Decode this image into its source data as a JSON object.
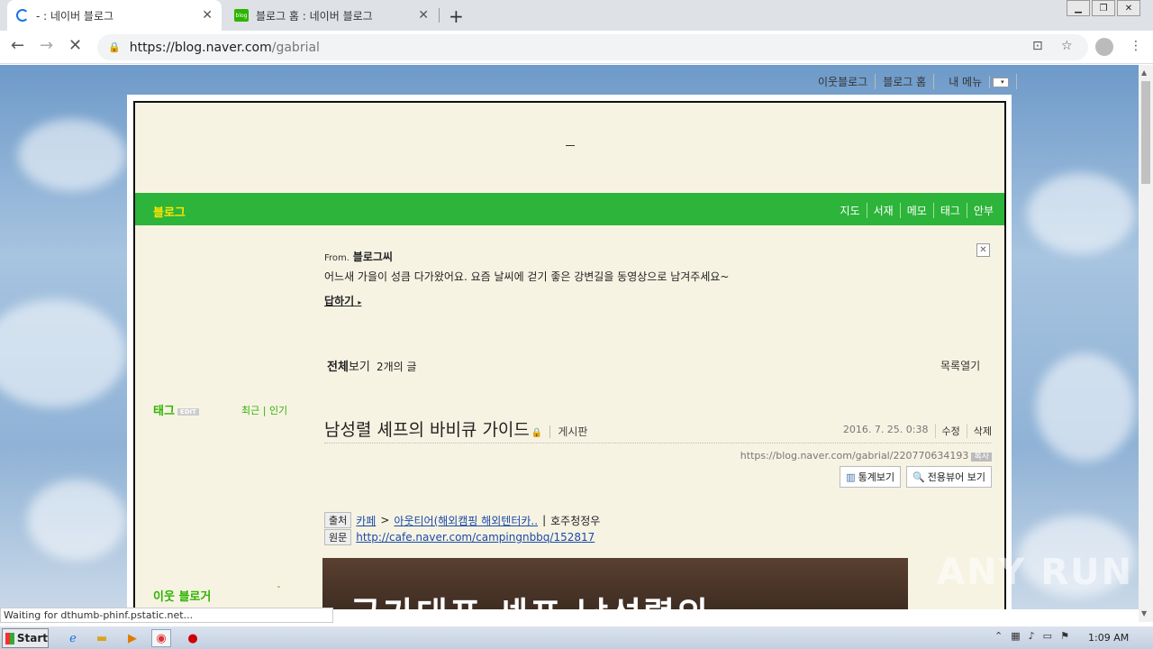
{
  "browser": {
    "tabs": [
      {
        "title": "- : 네이버 블로그",
        "favicon": "loading-spinner",
        "active": true
      },
      {
        "title": "블로그 홈 : 네이버 블로그",
        "favicon": "blog-icon",
        "active": false
      }
    ],
    "new_tab": "+",
    "url_host": "https://blog.naver.com",
    "url_path": "/gabrial",
    "status": "Waiting for dthumb-phinf.pstatic.net..."
  },
  "blog": {
    "top_menu": [
      "이웃블로그",
      "블로그 홈",
      "내 메뉴"
    ],
    "header_dash": "–",
    "name": "블로그",
    "nav": [
      "지도",
      "서재",
      "메모",
      "태그",
      "안부"
    ],
    "from_label": "From.",
    "from_sender": "블로그씨",
    "from_message": "어느새 가을이 성큼 다가왔어요. 요즘 날씨에 걷기 좋은 강변길을 동영상으로 남겨주세요~",
    "reply_label": "답하기",
    "list_all_bold": "전체",
    "list_all_rest": "보기",
    "list_count": "2개의 글",
    "list_open": "목록열기",
    "sidebar": {
      "tag_title": "태그",
      "tag_edit": "EDIT",
      "tag_sort": "최근 | 인기",
      "neighbor_title": "이웃 블로거"
    },
    "post": {
      "title": "남성렬 셰프의 바비큐 가이드",
      "category": "게시판",
      "date": "2016. 7. 25. 0:38",
      "edit": "수정",
      "delete": "삭제",
      "url": "https://blog.naver.com/gabrial/220770634193",
      "copy": "복사",
      "stats_btn": "통계보기",
      "viewer_btn": "전용뷰어 보기",
      "source_label": "출처",
      "source_cafe": "카페",
      "source_cafe_name": "아웃티어(해외캠핑 해외텐터카..",
      "source_author": "호주청정우",
      "origin_label": "원문",
      "origin_link": "http://cafe.naver.com/campingnbbq/152817",
      "image_text": "국가대표 셰프 남성렬의"
    }
  },
  "watermark": "ANY RUN",
  "taskbar": {
    "start": "Start",
    "clock": "1:09 AM"
  }
}
